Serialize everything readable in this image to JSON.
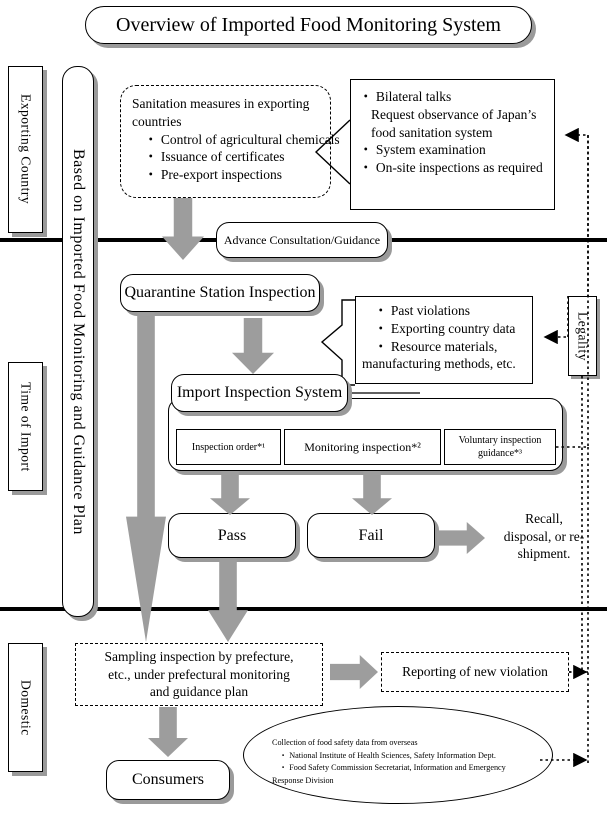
{
  "title": "Overview of Imported Food Monitoring System",
  "side_labels": {
    "exporting_country": "Exporting Country",
    "time_of_import": "Time of Import",
    "domestic": "Domestic",
    "plan_band": "Based on Imported Food Monitoring and Guidance Plan",
    "legality": "Legality"
  },
  "sanitation": {
    "heading_line1": "Sanitation measures in exporting",
    "heading_line2": "countries",
    "items": [
      "・ Control of agricultural chemicals",
      "・ Issuance of certificates",
      "・ Pre-export inspections"
    ]
  },
  "bilateral": {
    "items": [
      "・ Bilateral talks",
      "Request observance of Japan’s",
      "food sanitation system",
      "・ System examination",
      "・ On-site inspections as required"
    ]
  },
  "advance_consultation": "Advance Consultation/Guidance",
  "quarantine": "Quarantine Station Inspection",
  "violations": {
    "items": [
      "・ Past violations",
      "・ Exporting country data",
      "・ Resource materials,",
      "manufacturing methods, etc."
    ]
  },
  "import_inspection_system": "Import Inspection System",
  "inspection_types": [
    "Inspection order*¹",
    "Monitoring inspection*²",
    "Voluntary inspection guidance*³"
  ],
  "pass": "Pass",
  "fail": "Fail",
  "recall": {
    "line1": "Recall,",
    "line2": "disposal, or re-",
    "line3": "shipment."
  },
  "sampling": {
    "line1": "Sampling inspection by prefecture,",
    "line2": "etc., under prefectural monitoring",
    "line3": "and guidance plan"
  },
  "reporting": "Reporting of new violation",
  "consumers": "Consumers",
  "overseas_data": {
    "heading": "Collection of food safety data from overseas",
    "items": [
      "・ National Institute of Health Sciences, Safety Information Dept.",
      "・ Food Safety Commission Secretariat, Information and Emergency",
      "Response Division"
    ]
  },
  "colors": {
    "arrow_fill": "#9d9d9d",
    "shadow": "#9a9a9a",
    "line": "#000000",
    "background": "#ffffff"
  }
}
